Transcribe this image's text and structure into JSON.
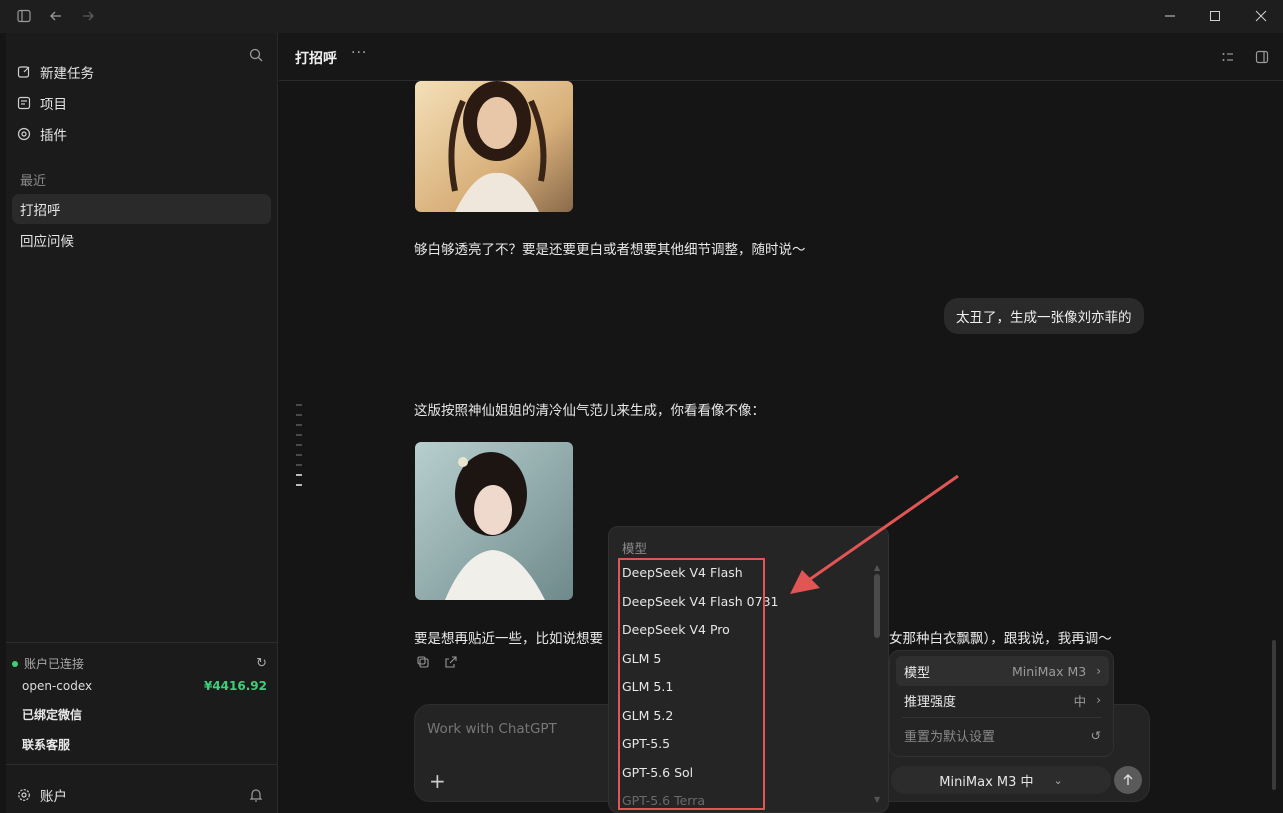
{
  "sidebar": {
    "new_task": "新建任务",
    "projects": "项目",
    "plugins": "插件",
    "recent_label": "最近",
    "recents": [
      "打招呼",
      "回应问候"
    ],
    "account_status": "账户已连接",
    "account_name": "open-codex",
    "balance": "¥4416.92",
    "wechat": "已绑定微信",
    "support": "联系客服",
    "account": "账户"
  },
  "header": {
    "title": "打招呼",
    "more": "···"
  },
  "chat": {
    "msg1": "够白够透亮了不？要是还要更白或者想要其他细节调整，随时说～",
    "user_msg": "太丑了，生成一张像刘亦菲的",
    "msg2": "这版按照神仙姐姐的清冷仙气范儿来生成，你看看像不像：",
    "msg3_left": "要是想再贴近一些，比如说想要",
    "msg3_right": "女那种白衣飘飘），跟我说，我再调～"
  },
  "composer": {
    "placeholder": "Work with ChatGPT",
    "plus": "+"
  },
  "model_menu": {
    "header": "模型",
    "items": [
      "DeepSeek V4 Flash",
      "DeepSeek V4 Flash 0731",
      "DeepSeek V4 Pro",
      "GLM 5",
      "GLM 5.1",
      "GLM 5.2",
      "GPT-5.5",
      "GPT-5.6 Sol",
      "GPT-5.6 Terra"
    ]
  },
  "settings": {
    "model_label": "模型",
    "model_value": "MiniMax M3",
    "effort_label": "推理强度",
    "effort_value": "中",
    "reset": "重置为默认设置"
  },
  "model_pill": {
    "label": "MiniMax M3 中"
  },
  "colors": {
    "annotation": "#e25555",
    "balance": "#3ecf7a",
    "status_dot": "#3ecf7a"
  }
}
